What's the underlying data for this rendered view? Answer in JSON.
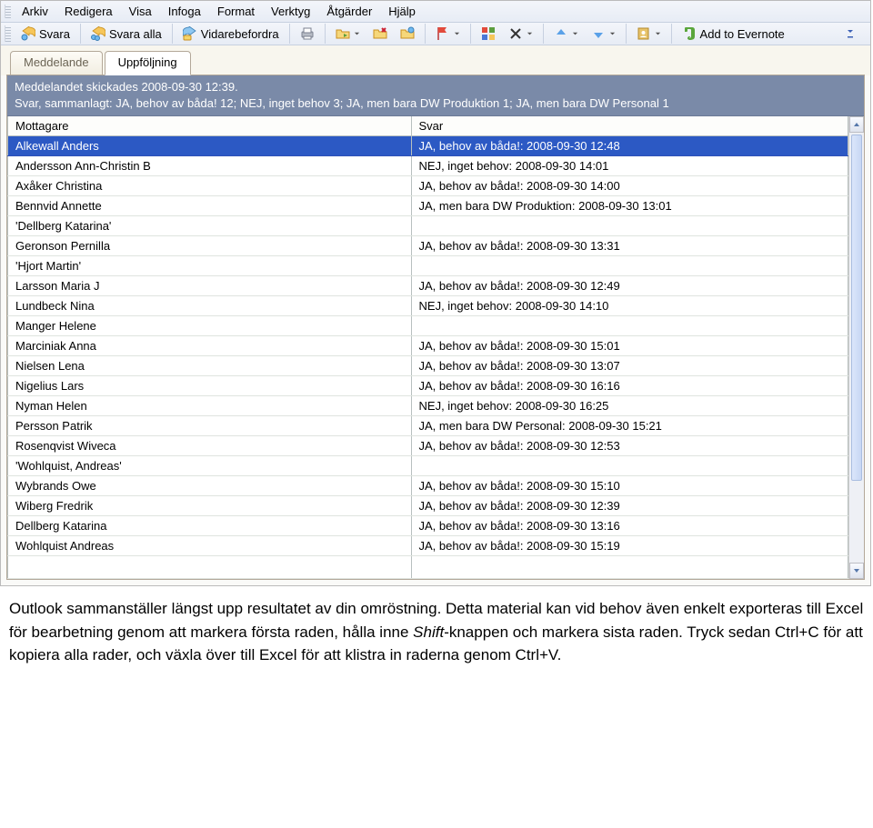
{
  "menus": [
    "Arkiv",
    "Redigera",
    "Visa",
    "Infoga",
    "Format",
    "Verktyg",
    "Åtgärder",
    "Hjälp"
  ],
  "toolbar": {
    "reply": "Svara",
    "reply_all": "Svara alla",
    "forward": "Vidarebefordra",
    "evernote": "Add to Evernote"
  },
  "tabs": {
    "message": "Meddelande",
    "followup": "Uppföljning"
  },
  "banner": {
    "line1": "Meddelandet skickades 2008-09-30 12:39.",
    "line2": "Svar, sammanlagt: JA, behov av båda! 12; NEJ, inget behov 3; JA, men bara DW Produktion 1; JA, men bara DW Personal 1"
  },
  "table": {
    "headers": {
      "recipient": "Mottagare",
      "answer": "Svar"
    },
    "rows": [
      {
        "recipient": "Alkewall Anders",
        "answer": "JA, behov av båda!: 2008-09-30 12:48",
        "selected": true
      },
      {
        "recipient": "Andersson Ann-Christin B",
        "answer": "NEJ, inget behov: 2008-09-30 14:01"
      },
      {
        "recipient": "Axåker Christina",
        "answer": "JA, behov av båda!: 2008-09-30 14:00"
      },
      {
        "recipient": "Bennvid Annette",
        "answer": "JA, men bara DW Produktion: 2008-09-30 13:01"
      },
      {
        "recipient": "'Dellberg Katarina'",
        "answer": ""
      },
      {
        "recipient": "Geronson Pernilla",
        "answer": "JA, behov av båda!: 2008-09-30 13:31"
      },
      {
        "recipient": "'Hjort Martin'",
        "answer": ""
      },
      {
        "recipient": "Larsson Maria J",
        "answer": "JA, behov av båda!: 2008-09-30 12:49"
      },
      {
        "recipient": "Lundbeck Nina",
        "answer": "NEJ, inget behov: 2008-09-30 14:10"
      },
      {
        "recipient": "Manger Helene",
        "answer": ""
      },
      {
        "recipient": "Marciniak Anna",
        "answer": "JA, behov av båda!: 2008-09-30 15:01"
      },
      {
        "recipient": "Nielsen Lena",
        "answer": "JA, behov av båda!: 2008-09-30 13:07"
      },
      {
        "recipient": "Nigelius Lars",
        "answer": "JA, behov av båda!: 2008-09-30 16:16"
      },
      {
        "recipient": "Nyman Helen",
        "answer": "NEJ, inget behov: 2008-09-30 16:25"
      },
      {
        "recipient": "Persson Patrik",
        "answer": "JA, men bara DW Personal: 2008-09-30 15:21"
      },
      {
        "recipient": "Rosenqvist Wiveca",
        "answer": "JA, behov av båda!: 2008-09-30 12:53"
      },
      {
        "recipient": "'Wohlquist, Andreas'",
        "answer": ""
      },
      {
        "recipient": "Wybrands Owe",
        "answer": "JA, behov av båda!: 2008-09-30 15:10"
      },
      {
        "recipient": "Wiberg Fredrik",
        "answer": "JA, behov av båda!: 2008-09-30 12:39"
      },
      {
        "recipient": "Dellberg Katarina",
        "answer": "JA, behov av båda!: 2008-09-30 13:16"
      },
      {
        "recipient": "Wohlquist Andreas",
        "answer": "JA, behov av båda!: 2008-09-30 15:19"
      }
    ]
  },
  "caption": {
    "p1a": "Outlook sammanställer längst upp resultatet av din omröstning. Detta material kan vid behov även enkelt exporteras till Excel för bearbetning genom att markera första raden, hålla inne ",
    "shift": "Shift",
    "p1b": "-knappen och markera sista raden. Tryck sedan Ctrl+C för att kopiera alla rader, och växla över till Excel för att klistra in raderna genom Ctrl+V."
  }
}
